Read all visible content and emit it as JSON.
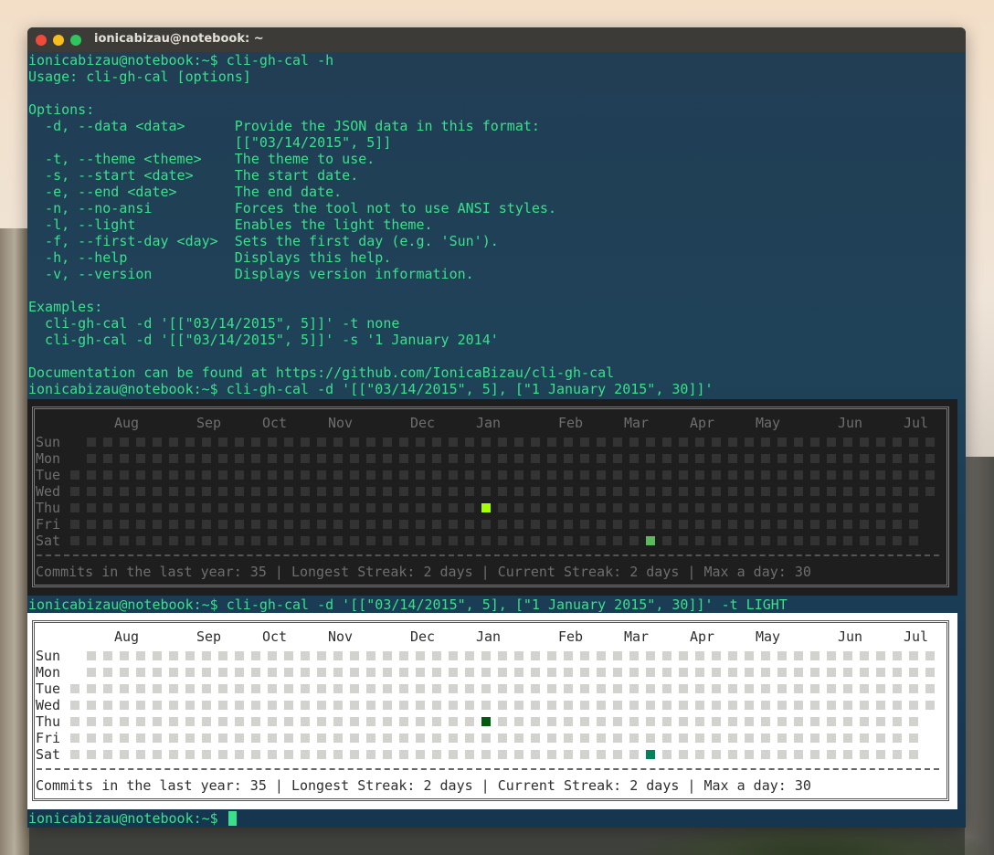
{
  "window": {
    "title": "ionicabizau@notebook: ~"
  },
  "terminal": {
    "prompt": "ionicabizau@notebook:~$",
    "lines": [
      "ionicabizau@notebook:~$ cli-gh-cal -h",
      "Usage: cli-gh-cal [options]",
      "",
      "Options:",
      "  -d, --data <data>      Provide the JSON data in this format:",
      "                         [[\"03/14/2015\", 5]]",
      "  -t, --theme <theme>    The theme to use.",
      "  -s, --start <date>     The start date.",
      "  -e, --end <date>       The end date.",
      "  -n, --no-ansi          Forces the tool not to use ANSI styles.",
      "  -l, --light            Enables the light theme.",
      "  -f, --first-day <day>  Sets the first day (e.g. 'Sun').",
      "  -h, --help             Displays this help.",
      "  -v, --version          Displays version information.",
      "",
      "Examples:",
      "  cli-gh-cal -d '[[\"03/14/2015\", 5]]' -t none",
      "  cli-gh-cal -d '[[\"03/14/2015\", 5]]' -s '1 January 2014'",
      "",
      "Documentation can be found at https://github.com/IonicaBizau/cli-gh-cal",
      "ionicabizau@notebook:~$ cli-gh-cal -d '[[\"03/14/2015\", 5], [\"1 January 2015\", 30]]'"
    ],
    "command_light": "ionicabizau@notebook:~$ cli-gh-cal -d '[[\"03/14/2015\", 5], [\"1 January 2015\", 30]]' -t LIGHT",
    "final_prompt": "ionicabizau@notebook:~$ "
  },
  "calendar": {
    "months": [
      "Aug",
      "Sep",
      "Oct",
      "Nov",
      "Dec",
      "Jan",
      "Feb",
      "Mar",
      "Apr",
      "May",
      "Jun",
      "Jul"
    ],
    "month_columns": [
      3,
      8,
      12,
      16,
      21,
      25,
      30,
      34,
      38,
      42,
      47,
      51
    ],
    "days": [
      "Sun",
      "Mon",
      "Tue",
      "Wed",
      "Thu",
      "Fri",
      "Sat"
    ],
    "weeks": 53,
    "first_week_start_row": 2,
    "last_week_end_row": 3,
    "contributions": [
      {
        "date": "1 January 2015",
        "count": 30,
        "week": 25,
        "day": 4
      },
      {
        "date": "03/14/2015",
        "count": 5,
        "week": 35,
        "day": 6
      }
    ],
    "max_count": 30,
    "footer": "Commits in the last year: 35 | Longest Streak: 2 days | Current Streak: 2 days | Max a day: 30",
    "stats": {
      "commits_last_year": 35,
      "longest_streak": "2 days",
      "current_streak": "2 days",
      "max_a_day": 30
    }
  },
  "themes": {
    "dark": {
      "empty": "#333333",
      "level_high": "#a6ff00",
      "level_low": "#5cb85c"
    },
    "light": {
      "empty": "#d2d3cf",
      "level_high": "#005a0f",
      "level_low": "#00835a"
    }
  }
}
